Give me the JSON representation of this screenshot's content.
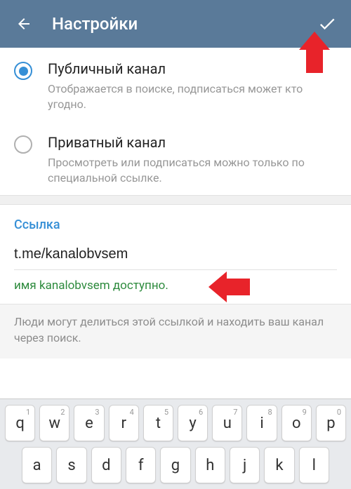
{
  "header": {
    "title": "Настройки"
  },
  "channel_type": {
    "public": {
      "title": "Публичный канал",
      "desc": "Отображается в поиске, подписаться может кто угодно."
    },
    "private": {
      "title": "Приватный канал",
      "desc": "Просмотреть или подписаться можно только по специальной ссылке."
    }
  },
  "link": {
    "label": "Ссылка",
    "value": "t.me/kanalobvsem",
    "status": "имя kanalobvsem доступно."
  },
  "hint": "Люди могут делиться этой ссылкой и находить ваш канал через поиск.",
  "keyboard": {
    "row1": [
      {
        "num": "1",
        "letter": "q"
      },
      {
        "num": "2",
        "letter": "w"
      },
      {
        "num": "3",
        "letter": "e"
      },
      {
        "num": "4",
        "letter": "r"
      },
      {
        "num": "5",
        "letter": "t"
      },
      {
        "num": "6",
        "letter": "y"
      },
      {
        "num": "7",
        "letter": "u"
      },
      {
        "num": "8",
        "letter": "i"
      },
      {
        "num": "9",
        "letter": "o"
      },
      {
        "num": "0",
        "letter": "p"
      }
    ],
    "row2": [
      {
        "letter": "a"
      },
      {
        "letter": "s"
      },
      {
        "letter": "d"
      },
      {
        "letter": "f"
      },
      {
        "letter": "g"
      },
      {
        "letter": "h"
      },
      {
        "letter": "j"
      },
      {
        "letter": "k"
      },
      {
        "letter": "l"
      }
    ]
  }
}
